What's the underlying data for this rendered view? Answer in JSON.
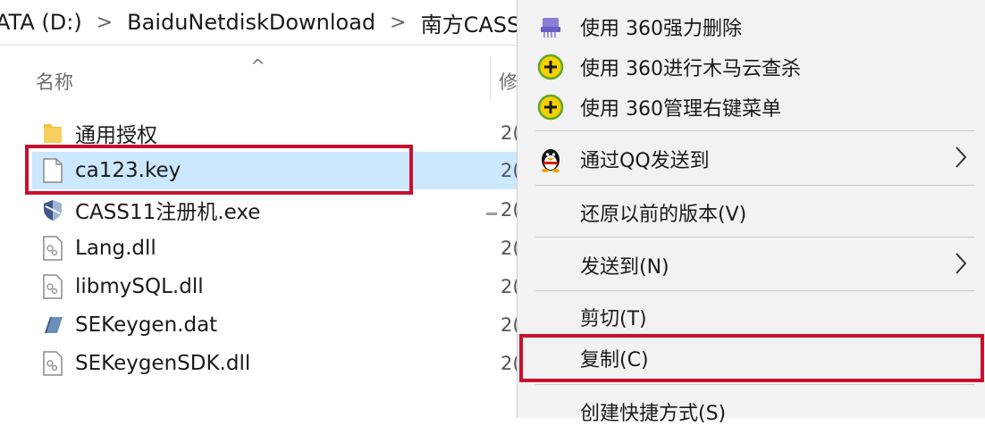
{
  "breadcrumb": {
    "items": [
      "ATA (D:)",
      "BaiduNetdiskDownload",
      "南方CASS"
    ],
    "separator": ">"
  },
  "columns": {
    "name": "名称",
    "sort_indicator": "^",
    "modified": "修"
  },
  "files": [
    {
      "name": "通用授权",
      "date": "2(",
      "icon": "folder-icon"
    },
    {
      "name": "ca123.key",
      "date": "2(",
      "icon": "blank-file-icon",
      "selected": true
    },
    {
      "name": "CASS11注册机.exe",
      "date": "2(",
      "icon": "exe-shield-icon"
    },
    {
      "name": "Lang.dll",
      "date": "2(",
      "icon": "dll-file-icon"
    },
    {
      "name": "libmySQL.dll",
      "date": "2(",
      "icon": "dll-file-icon"
    },
    {
      "name": "SEKeygen.dat",
      "date": "2(",
      "icon": "dat-file-icon"
    },
    {
      "name": "SEKeygenSDK.dll",
      "date": "2(",
      "icon": "dll-file-icon"
    }
  ],
  "context_menu": {
    "items": [
      {
        "label": "使用 360强力删除",
        "icon": "360-shred-icon"
      },
      {
        "label": "使用 360进行木马云查杀",
        "icon": "360-plus-icon"
      },
      {
        "label": "使用 360管理右键菜单",
        "icon": "360-plus-icon"
      },
      {
        "label": "通过QQ发送到",
        "icon": "qq-penguin-icon",
        "submenu": true
      },
      {
        "label": "还原以前的版本(V)"
      },
      {
        "label": "发送到(N)",
        "submenu": true
      },
      {
        "label": "剪切(T)"
      },
      {
        "label": "复制(C)",
        "highlighted": true
      },
      {
        "label": "创建快捷方式(S)"
      }
    ]
  },
  "colors": {
    "selection": "#cce8ff",
    "highlight_border": "#c8102e",
    "menu_background": "#f2f2f2"
  }
}
